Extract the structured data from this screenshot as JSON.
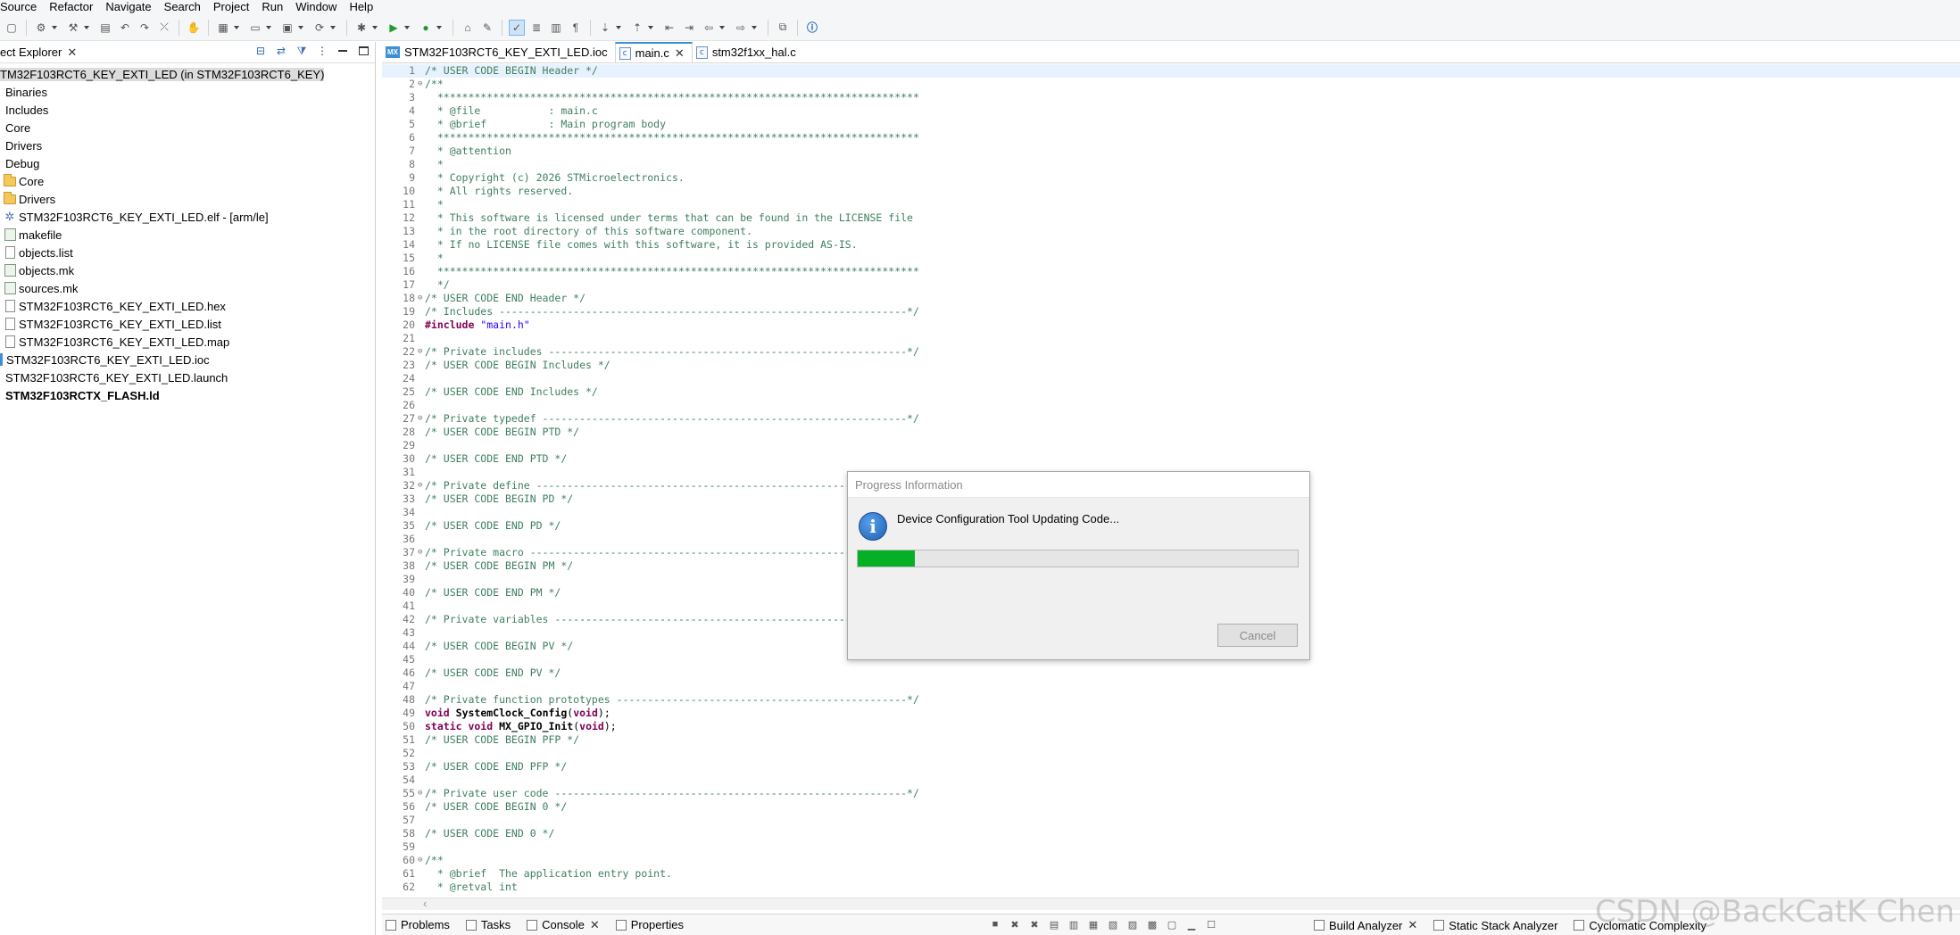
{
  "menu": [
    "Source",
    "Refactor",
    "Navigate",
    "Search",
    "Project",
    "Run",
    "Window",
    "Help"
  ],
  "explorer": {
    "title": "ect Explorer",
    "items": [
      {
        "label": "TM32F103RCT6_KEY_EXTI_LED (in STM32F103RCT6_KEY)",
        "icon": "project-icon",
        "indent": 0,
        "selected": true
      },
      {
        "label": "Binaries",
        "icon": "binaries-icon",
        "indent": 0
      },
      {
        "label": "Includes",
        "icon": "includes-icon",
        "indent": 0
      },
      {
        "label": "Core",
        "icon": "source-folder-icon",
        "indent": 0
      },
      {
        "label": "Drivers",
        "icon": "source-folder-icon",
        "indent": 0
      },
      {
        "label": "Debug",
        "icon": "folder-icon",
        "indent": 0
      },
      {
        "label": "Core",
        "icon": "folder-icon",
        "indent": 1
      },
      {
        "label": "Drivers",
        "icon": "folder-icon",
        "indent": 1
      },
      {
        "label": "STM32F103RCT6_KEY_EXTI_LED.elf - [arm/le]",
        "icon": "gear-icon",
        "indent": 1
      },
      {
        "label": "makefile",
        "icon": "makefile-icon",
        "indent": 1
      },
      {
        "label": "objects.list",
        "icon": "file-icon",
        "indent": 1
      },
      {
        "label": "objects.mk",
        "icon": "makefile-icon",
        "indent": 1
      },
      {
        "label": "sources.mk",
        "icon": "makefile-icon",
        "indent": 1
      },
      {
        "label": "STM32F103RCT6_KEY_EXTI_LED.hex",
        "icon": "file-icon",
        "indent": 1
      },
      {
        "label": "STM32F103RCT6_KEY_EXTI_LED.list",
        "icon": "file-icon",
        "indent": 1
      },
      {
        "label": "STM32F103RCT6_KEY_EXTI_LED.map",
        "icon": "file-icon",
        "indent": 1
      },
      {
        "label": "STM32F103RCT6_KEY_EXTI_LED.ioc",
        "icon": "ioc-icon",
        "indent": 0
      },
      {
        "label": "STM32F103RCT6_KEY_EXTI_LED.launch",
        "icon": "launch-icon",
        "indent": 0
      },
      {
        "label": "STM32F103RCTX_FLASH.ld",
        "icon": "linker-icon",
        "indent": 0,
        "bold": true
      }
    ]
  },
  "editor": {
    "tabs": [
      {
        "label": "STM32F103RCT6_KEY_EXTI_LED.ioc",
        "icon": "mx-icon",
        "active": false
      },
      {
        "label": "main.c",
        "icon": "c-file-icon",
        "active": true
      },
      {
        "label": "stm32f1xx_hal.c",
        "icon": "c-file-icon",
        "active": false
      }
    ],
    "lines": [
      {
        "n": "1",
        "t": "/* USER CODE BEGIN Header */"
      },
      {
        "n": "2",
        "f": true,
        "t": "/**"
      },
      {
        "n": "3",
        "t": "  ******************************************************************************"
      },
      {
        "n": "4",
        "t": "  * @file           : main.c"
      },
      {
        "n": "5",
        "t": "  * @brief          : Main program body"
      },
      {
        "n": "6",
        "t": "  ******************************************************************************"
      },
      {
        "n": "7",
        "t": "  * @attention"
      },
      {
        "n": "8",
        "t": "  *"
      },
      {
        "n": "9",
        "t": "  * Copyright (c) 2026 STMicroelectronics."
      },
      {
        "n": "10",
        "t": "  * All rights reserved."
      },
      {
        "n": "11",
        "t": "  *"
      },
      {
        "n": "12",
        "t": "  * This software is licensed under terms that can be found in the LICENSE file"
      },
      {
        "n": "13",
        "t": "  * in the root directory of this software component."
      },
      {
        "n": "14",
        "t": "  * If no LICENSE file comes with this software, it is provided AS-IS."
      },
      {
        "n": "15",
        "t": "  *"
      },
      {
        "n": "16",
        "t": "  ******************************************************************************"
      },
      {
        "n": "17",
        "t": "  */"
      },
      {
        "n": "18",
        "f": true,
        "t": "/* USER CODE END Header */"
      },
      {
        "n": "19",
        "t": "/* Includes ------------------------------------------------------------------*/"
      },
      {
        "n": "20",
        "k": "include",
        "t": "#include",
        "s": "\"main.h\""
      },
      {
        "n": "21",
        "t": ""
      },
      {
        "n": "22",
        "f": true,
        "t": "/* Private includes ----------------------------------------------------------*/"
      },
      {
        "n": "23",
        "t": "/* USER CODE BEGIN Includes */"
      },
      {
        "n": "24",
        "t": ""
      },
      {
        "n": "25",
        "t": "/* USER CODE END Includes */"
      },
      {
        "n": "26",
        "t": ""
      },
      {
        "n": "27",
        "f": true,
        "t": "/* Private typedef -----------------------------------------------------------*/"
      },
      {
        "n": "28",
        "t": "/* USER CODE BEGIN PTD */"
      },
      {
        "n": "29",
        "t": ""
      },
      {
        "n": "30",
        "t": "/* USER CODE END PTD */"
      },
      {
        "n": "31",
        "t": ""
      },
      {
        "n": "32",
        "f": true,
        "t": "/* Private define ------------------------------------------------------------*/"
      },
      {
        "n": "33",
        "t": "/* USER CODE BEGIN PD */"
      },
      {
        "n": "34",
        "t": ""
      },
      {
        "n": "35",
        "t": "/* USER CODE END PD */"
      },
      {
        "n": "36",
        "t": ""
      },
      {
        "n": "37",
        "f": true,
        "t": "/* Private macro -------------------------------------------------------------*/"
      },
      {
        "n": "38",
        "t": "/* USER CODE BEGIN PM */"
      },
      {
        "n": "39",
        "t": ""
      },
      {
        "n": "40",
        "t": "/* USER CODE END PM */"
      },
      {
        "n": "41",
        "t": ""
      },
      {
        "n": "42",
        "t": "/* Private variables ---------------------------------------------------------*/"
      },
      {
        "n": "43",
        "t": ""
      },
      {
        "n": "44",
        "t": "/* USER CODE BEGIN PV */"
      },
      {
        "n": "45",
        "t": ""
      },
      {
        "n": "46",
        "t": "/* USER CODE END PV */"
      },
      {
        "n": "47",
        "t": ""
      },
      {
        "n": "48",
        "t": "/* Private function prototypes -----------------------------------------------*/"
      },
      {
        "n": "49",
        "k": "decl",
        "kw": "void",
        "fn": "SystemClock_Config",
        "p": "(",
        "a": "void",
        "e": ");"
      },
      {
        "n": "50",
        "k": "decl",
        "kw": "static void",
        "fn": "MX_GPIO_Init",
        "p": "(",
        "a": "void",
        "e": ");"
      },
      {
        "n": "51",
        "t": "/* USER CODE BEGIN PFP */"
      },
      {
        "n": "52",
        "t": ""
      },
      {
        "n": "53",
        "t": "/* USER CODE END PFP */"
      },
      {
        "n": "54",
        "t": ""
      },
      {
        "n": "55",
        "f": true,
        "t": "/* Private user code ---------------------------------------------------------*/"
      },
      {
        "n": "56",
        "t": "/* USER CODE BEGIN 0 */"
      },
      {
        "n": "57",
        "t": ""
      },
      {
        "n": "58",
        "t": "/* USER CODE END 0 */"
      },
      {
        "n": "59",
        "t": ""
      },
      {
        "n": "60",
        "f": true,
        "t": "/**"
      },
      {
        "n": "61",
        "t": "  * @brief  The application entry point."
      },
      {
        "n": "62",
        "t": "  * @retval int"
      }
    ]
  },
  "bottom": {
    "left_tabs": [
      "Problems",
      "Tasks",
      "Console",
      "Properties"
    ],
    "right_tabs": [
      "Build Analyzer",
      "Static Stack Analyzer",
      "Cyclomatic Complexity"
    ]
  },
  "dialog": {
    "title": "Progress Information",
    "message": "Device Configuration Tool Updating Code...",
    "progress": 0.13,
    "cancel": "Cancel",
    "progress_color": "#06b025"
  },
  "watermark": "CSDN @BackCatK Chen"
}
